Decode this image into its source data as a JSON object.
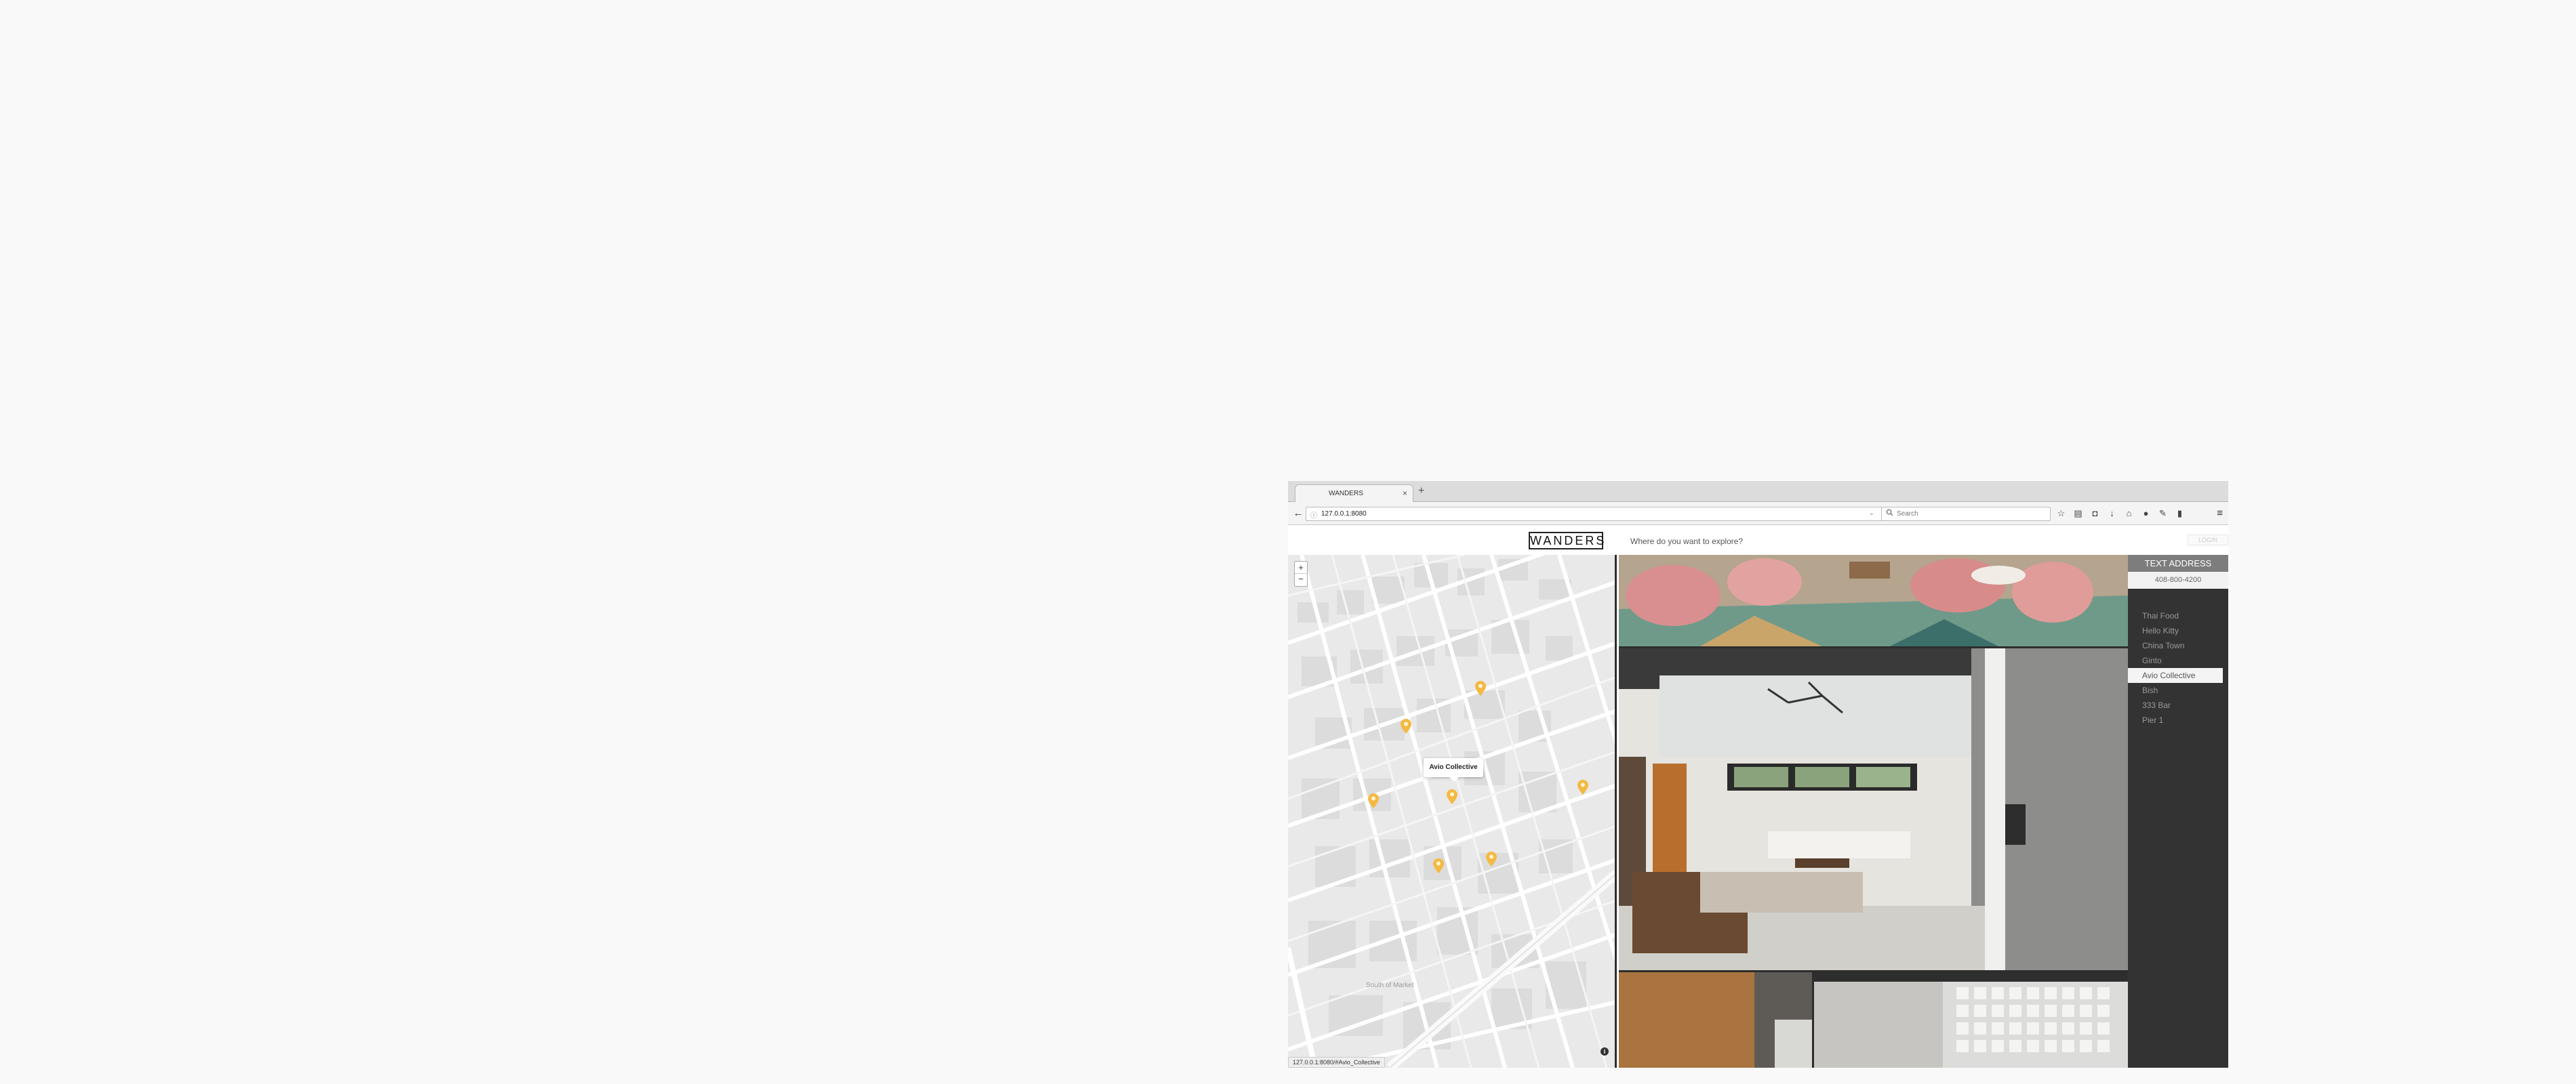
{
  "browser": {
    "tab_title": "WANDERS",
    "tab_close": "×",
    "new_tab": "+",
    "url": "127.0.0.1:8080",
    "search_placeholder": "Search"
  },
  "site": {
    "logo": "WANDERS",
    "explore_prompt": "Where do you want to explore?",
    "login": "LOGIN"
  },
  "map": {
    "zoom_in": "+",
    "zoom_out": "−",
    "popup_label": "Avio Collective",
    "district_label": "South of Market",
    "status_url": "127.0.0.1:8080/#Avio_Collective",
    "pin_color": "#f4b942"
  },
  "panel": {
    "text_address_label": "TEXT ADDRESS",
    "phone": "408-800-4200",
    "places": [
      {
        "label": "Thai Food",
        "active": false
      },
      {
        "label": "Hello Kitty",
        "active": false
      },
      {
        "label": "China Town",
        "active": false
      },
      {
        "label": "Ginto",
        "active": false
      },
      {
        "label": "Avio Collective",
        "active": true
      },
      {
        "label": "Bish",
        "active": false
      },
      {
        "label": "333 Bar",
        "active": false
      },
      {
        "label": "Pier 1",
        "active": false
      }
    ]
  }
}
